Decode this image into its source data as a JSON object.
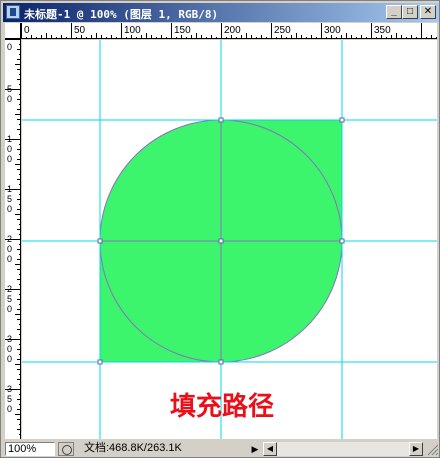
{
  "window": {
    "title": "未标题-1 @ 100% (图层 1, RGB/8)",
    "minimize_glyph": "_",
    "maximize_glyph": "□",
    "close_glyph": "✕"
  },
  "rulers": {
    "horizontal_labels": [
      "0",
      "50",
      "100",
      "150",
      "200",
      "250",
      "300",
      "350"
    ],
    "vertical_labels": [
      "0",
      "50",
      "100",
      "150",
      "200",
      "250",
      "300",
      "350"
    ]
  },
  "canvas": {
    "fill_color": "#3df56c",
    "path_color": "#8a6fc4",
    "guide_color": "#00d8e8",
    "caption": "填充路径",
    "caption_color": "#e8101a"
  },
  "statusbar": {
    "zoom": "100%",
    "doc_info": "文档:468.8K/263.1K",
    "arrow_glyph": "▶",
    "scroll_left_glyph": "◀",
    "scroll_right_glyph": "▶"
  }
}
